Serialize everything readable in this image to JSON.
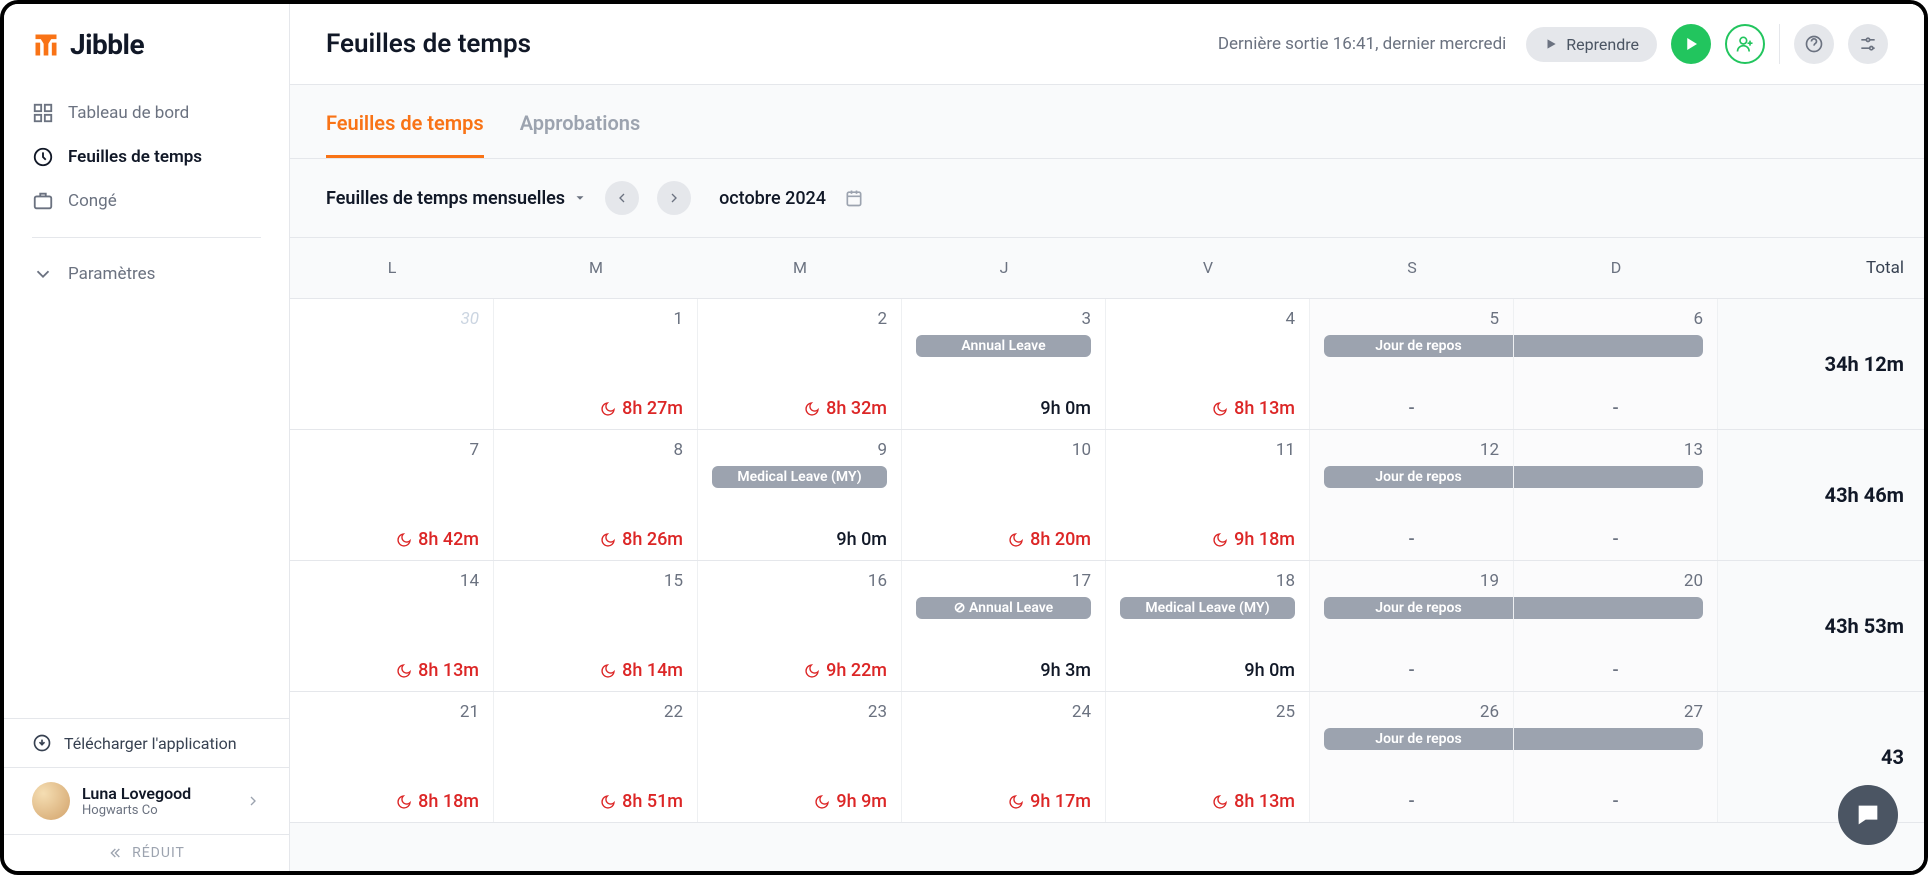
{
  "logo": "Jibble",
  "sidebar": {
    "items": [
      {
        "label": "Tableau de bord"
      },
      {
        "label": "Feuilles de temps"
      },
      {
        "label": "Congé"
      },
      {
        "label": "Paramètres"
      }
    ],
    "download": "Télécharger l'application",
    "user": {
      "name": "Luna Lovegood",
      "org": "Hogwarts Co"
    },
    "reduit": "RÉDUIT"
  },
  "header": {
    "title": "Feuilles de temps",
    "last_out": "Dernière sortie 16:41, dernier mercredi",
    "resume": "Reprendre"
  },
  "tabs": [
    {
      "label": "Feuilles de temps",
      "active": true
    },
    {
      "label": "Approbations",
      "active": false
    }
  ],
  "controls": {
    "view": "Feuilles de temps mensuelles",
    "period": "octobre 2024"
  },
  "cal": {
    "days": [
      "L",
      "M",
      "M",
      "J",
      "V",
      "S",
      "D"
    ],
    "total_label": "Total",
    "weeks": [
      {
        "total": "34h 12m",
        "cells": [
          {
            "n": "30",
            "faded": true
          },
          {
            "n": "1",
            "t": "8h 27m",
            "warn": true
          },
          {
            "n": "2",
            "t": "8h 32m",
            "warn": true
          },
          {
            "n": "3",
            "t": "9h 0m",
            "badge": "Annual Leave"
          },
          {
            "n": "4",
            "t": "8h 13m",
            "warn": true
          },
          {
            "n": "5",
            "t": "-",
            "badge": "Jour de repos",
            "span": "start"
          },
          {
            "n": "6",
            "t": "-",
            "span": "end"
          }
        ]
      },
      {
        "total": "43h 46m",
        "cells": [
          {
            "n": "7",
            "t": "8h 42m",
            "warn": true
          },
          {
            "n": "8",
            "t": "8h 26m",
            "warn": true
          },
          {
            "n": "9",
            "t": "9h 0m",
            "badge": "Medical Leave (MY)"
          },
          {
            "n": "10",
            "t": "8h 20m",
            "warn": true
          },
          {
            "n": "11",
            "t": "9h 18m",
            "warn": true
          },
          {
            "n": "12",
            "t": "-",
            "badge": "Jour de repos",
            "span": "start"
          },
          {
            "n": "13",
            "t": "-",
            "span": "end"
          }
        ]
      },
      {
        "total": "43h 53m",
        "cells": [
          {
            "n": "14",
            "t": "8h 13m",
            "warn": true
          },
          {
            "n": "15",
            "t": "8h 14m",
            "warn": true
          },
          {
            "n": "16",
            "t": "9h 22m",
            "warn": true
          },
          {
            "n": "17",
            "t": "9h 3m",
            "badge": "⊘ Annual Leave"
          },
          {
            "n": "18",
            "t": "9h 0m",
            "badge": "Medical Leave (MY)"
          },
          {
            "n": "19",
            "t": "-",
            "badge": "Jour de repos",
            "span": "start"
          },
          {
            "n": "20",
            "t": "-",
            "span": "end"
          }
        ]
      },
      {
        "total": "43",
        "cells": [
          {
            "n": "21",
            "t": "8h 18m",
            "warn": true
          },
          {
            "n": "22",
            "t": "8h 51m",
            "warn": true
          },
          {
            "n": "23",
            "t": "9h 9m",
            "warn": true
          },
          {
            "n": "24",
            "t": "9h 17m",
            "warn": true
          },
          {
            "n": "25",
            "t": "8h 13m",
            "warn": true
          },
          {
            "n": "26",
            "t": "-",
            "badge": "Jour de repos",
            "span": "start"
          },
          {
            "n": "27",
            "t": "-",
            "span": "end"
          }
        ]
      }
    ]
  }
}
